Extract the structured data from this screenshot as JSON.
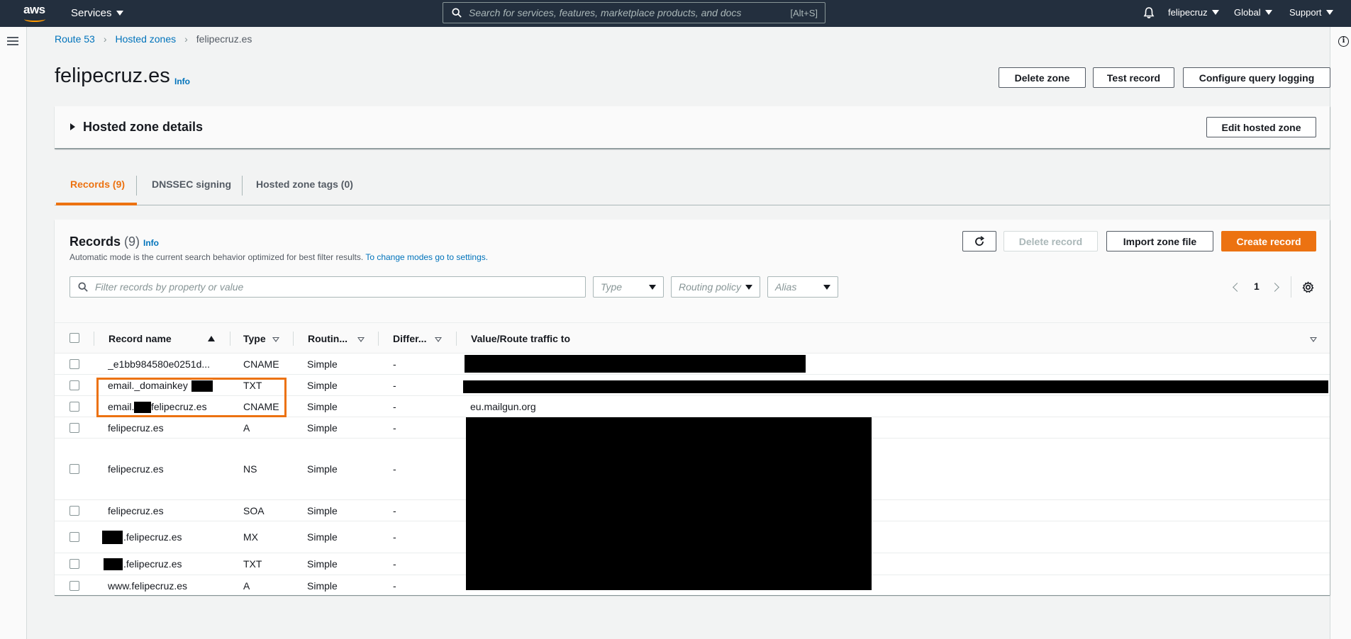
{
  "nav": {
    "logo": "aws",
    "services": "Services",
    "search_placeholder": "Search for services, features, marketplace products, and docs",
    "search_shortcut": "[Alt+S]",
    "user": "felipecruz",
    "region": "Global",
    "support": "Support"
  },
  "breadcrumb": {
    "root": "Route 53",
    "parent": "Hosted zones",
    "current": "felipecruz.es"
  },
  "page": {
    "title": "felipecruz.es",
    "info": "Info",
    "delete_zone": "Delete zone",
    "test_record": "Test record",
    "configure_logging": "Configure query logging"
  },
  "hosted_zone": {
    "details_label": "Hosted zone details",
    "edit": "Edit hosted zone"
  },
  "tabs": {
    "records": "Records (9)",
    "dnssec": "DNSSEC signing",
    "tags": "Hosted zone tags (0)"
  },
  "records": {
    "title": "Records",
    "count": "(9)",
    "info": "Info",
    "description": "Automatic mode is the current search behavior optimized for best filter results.",
    "description_link": "To change modes go to settings.",
    "delete_record": "Delete record",
    "import_zone": "Import zone file",
    "create_record": "Create record",
    "filter_placeholder": "Filter records by property or value",
    "type_select": "Type",
    "routing_select": "Routing policy",
    "alias_select": "Alias",
    "page_number": "1"
  },
  "table": {
    "headers": {
      "name": "Record name",
      "type": "Type",
      "routing": "Routin...",
      "differ": "Differ...",
      "value": "Value/Route traffic to"
    },
    "rows": [
      {
        "name": "_e1bb984580e0251d...",
        "type": "CNAME",
        "routing": "Simple",
        "differ": "-",
        "value": ""
      },
      {
        "name": "email._domainkey",
        "type": "TXT",
        "routing": "Simple",
        "differ": "-",
        "value": ""
      },
      {
        "name": "email.",
        "name2": "felipecruz.es",
        "type": "CNAME",
        "routing": "Simple",
        "differ": "-",
        "value": "eu.mailgun.org"
      },
      {
        "name": "felipecruz.es",
        "type": "A",
        "routing": "Simple",
        "differ": "-",
        "value": ""
      },
      {
        "name": "felipecruz.es",
        "type": "NS",
        "routing": "Simple",
        "differ": "-",
        "value": ""
      },
      {
        "name": "felipecruz.es",
        "type": "SOA",
        "routing": "Simple",
        "differ": "-",
        "value": ""
      },
      {
        "name": ".felipecruz.es",
        "type": "MX",
        "routing": "Simple",
        "differ": "-",
        "value": ""
      },
      {
        "name": ".felipecruz.es",
        "type": "TXT",
        "routing": "Simple",
        "differ": "-",
        "value": ""
      },
      {
        "name": "www.felipecruz.es",
        "type": "A",
        "routing": "Simple",
        "differ": "-",
        "value": ""
      }
    ]
  },
  "colors": {
    "nav_bg": "#232f3e",
    "accent": "#ec7211",
    "link": "#0073bb",
    "highlight": "#ec7211"
  }
}
